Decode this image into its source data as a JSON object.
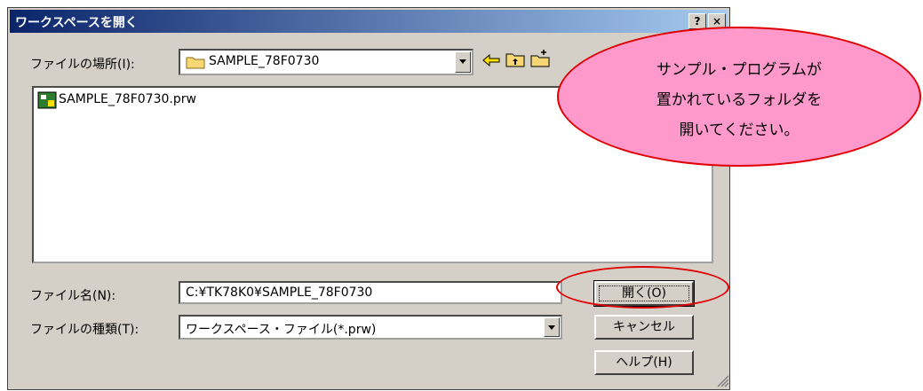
{
  "dialog": {
    "title": "ワークスペースを開く",
    "help_button": "?",
    "close_button": "×"
  },
  "location": {
    "label": "ファイルの場所(I):",
    "value": "SAMPLE_78F0730"
  },
  "files": [
    {
      "name": "SAMPLE_78F0730.prw"
    }
  ],
  "filename": {
    "label": "ファイル名(N):",
    "value": "C:¥TK78K0¥SAMPLE_78F0730"
  },
  "filetype": {
    "label": "ファイルの種類(T):",
    "value": "ワークスペース・ファイル(*.prw)"
  },
  "buttons": {
    "open": "開く(O)",
    "cancel": "キャンセル",
    "help": "ヘルプ(H)"
  },
  "callout": {
    "lines": [
      "サンプル・プログラムが",
      "置かれているフォルダを",
      "開いてください。"
    ]
  },
  "colors": {
    "callout_fill": "#ff99cc",
    "annotation_red": "#e00000",
    "titlebar": "#0a246a"
  }
}
